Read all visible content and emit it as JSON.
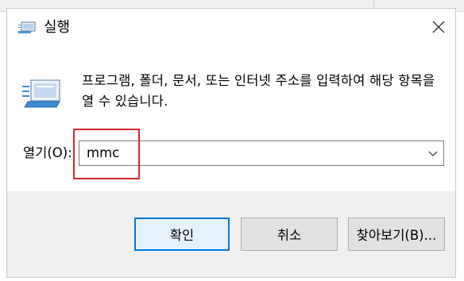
{
  "window": {
    "title": "실행",
    "icon": "run-app-icon",
    "close_icon": "close-icon"
  },
  "body": {
    "description": "프로그램, 폴더, 문서, 또는 인터넷 주소를 입력하여 해당 항목을 열 수 있습니다.",
    "icon": "run-app-icon"
  },
  "open_field": {
    "label": "열기(O):",
    "value": "mmc",
    "dropdown_icon": "chevron-down-icon"
  },
  "buttons": {
    "ok": "확인",
    "cancel": "취소",
    "browse": "찾아보기(B)..."
  },
  "colors": {
    "highlight": "#d9262c",
    "default_button_border": "#0078d7",
    "button_bar": "#f0f0f0"
  }
}
